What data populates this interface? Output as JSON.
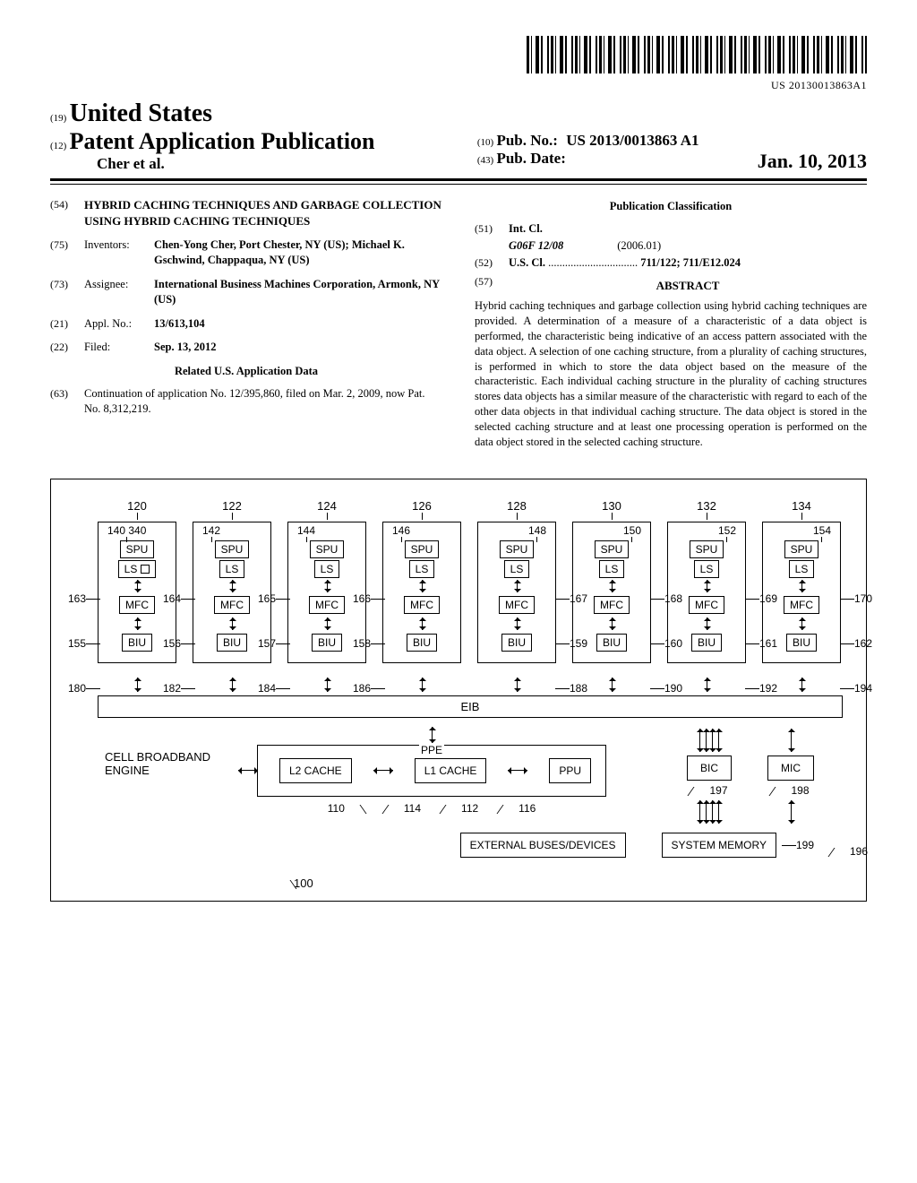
{
  "barcode_label": "US 20130013863A1",
  "header": {
    "country_code": "(19)",
    "country": "United States",
    "pub_code": "(12)",
    "pub_title": "Patent Application Publication",
    "authors": "Cher et al.",
    "pubno_code": "(10)",
    "pubno_label": "Pub. No.:",
    "pubno": "US 2013/0013863 A1",
    "pubdate_code": "(43)",
    "pubdate_label": "Pub. Date:",
    "pubdate": "Jan. 10, 2013"
  },
  "left": {
    "title_code": "(54)",
    "title": "HYBRID CACHING TECHNIQUES AND GARBAGE COLLECTION USING HYBRID CACHING TECHNIQUES",
    "inventors_code": "(75)",
    "inventors_label": "Inventors:",
    "inventors": "Chen-Yong Cher, Port Chester, NY (US); Michael K. Gschwind, Chappaqua, NY (US)",
    "assignee_code": "(73)",
    "assignee_label": "Assignee:",
    "assignee": "International Business Machines Corporation, Armonk, NY (US)",
    "applno_code": "(21)",
    "applno_label": "Appl. No.:",
    "applno": "13/613,104",
    "filed_code": "(22)",
    "filed_label": "Filed:",
    "filed": "Sep. 13, 2012",
    "related_header": "Related U.S. Application Data",
    "cont_code": "(63)",
    "cont": "Continuation of application No. 12/395,860, filed on Mar. 2, 2009, now Pat. No. 8,312,219."
  },
  "right": {
    "classification_header": "Publication Classification",
    "intcl_code": "(51)",
    "intcl_label": "Int. Cl.",
    "intcl_class": "G06F 12/08",
    "intcl_date": "(2006.01)",
    "uscl_code": "(52)",
    "uscl_label": "U.S. Cl.",
    "uscl_dots": "................................",
    "uscl_val": "711/122; 711/E12.024",
    "abstract_code": "(57)",
    "abstract_header": "ABSTRACT",
    "abstract": "Hybrid caching techniques and garbage collection using hybrid caching techniques are provided. A determination of a measure of a characteristic of a data object is performed, the characteristic being indicative of an access pattern associated with the data object. A selection of one caching structure, from a plurality of caching structures, is performed in which to store the data object based on the measure of the characteristic. Each individual caching structure in the plurality of caching structures stores data objects has a similar measure of the characteristic with regard to each of the other data objects in that individual caching structure. The data object is stored in the selected caching structure and at least one processing operation is performed on the data object stored in the selected caching structure."
  },
  "figure": {
    "top_labels": [
      "120",
      "122",
      "124",
      "126",
      "128",
      "130",
      "132",
      "134"
    ],
    "spu_labels": [
      "140   340",
      "142",
      "144",
      "146",
      "148",
      "150",
      "152",
      "154"
    ],
    "spu": "SPU",
    "ls": "LS",
    "mfc": "MFC",
    "biu": "BIU",
    "ls_nums": [
      "163",
      "164",
      "165",
      "166",
      "167",
      "168",
      "169",
      "170"
    ],
    "mfc_nums": [
      "155",
      "156",
      "157",
      "158",
      "159",
      "160",
      "161",
      "162"
    ],
    "biu_nums": [
      "180",
      "182",
      "184",
      "186",
      "188",
      "190",
      "192",
      "194"
    ],
    "eib": "EIB",
    "eib_num": "196",
    "cbe": "CELL BROADBAND ENGINE",
    "ppe": "PPE",
    "l2": "L2 CACHE",
    "l1": "L1 CACHE",
    "ppu": "PPU",
    "ppe_num": "110",
    "l2_num": "114",
    "l1_num": "112",
    "ppu_num": "116",
    "bic": "BIC",
    "mic": "MIC",
    "bic_num": "197",
    "mic_num": "198",
    "ext": "EXTERNAL BUSES/DEVICES",
    "mem": "SYSTEM MEMORY",
    "mem_num": "199",
    "ref100": "100"
  }
}
